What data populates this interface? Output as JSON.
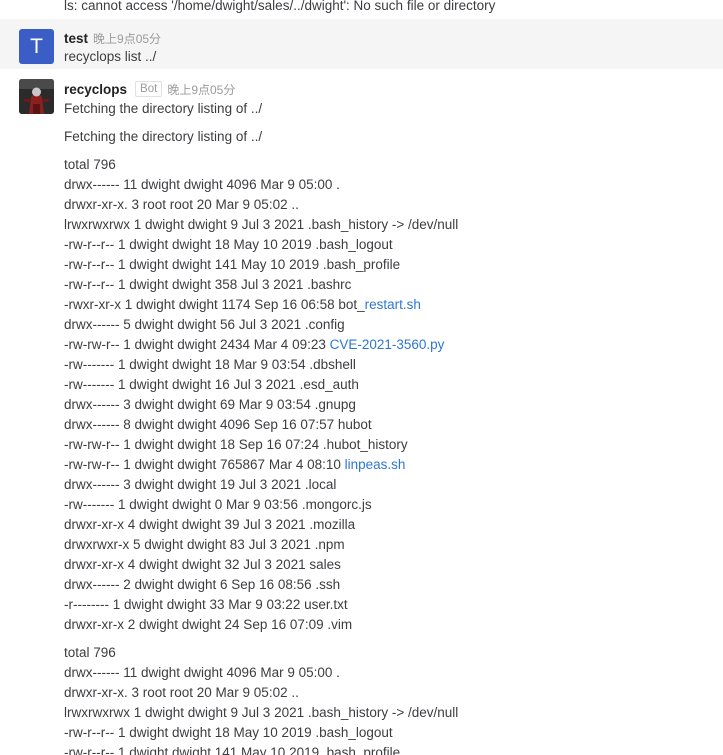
{
  "previous_line": "ls: cannot access '/home/dwight/sales/../dwight': No such file or directory",
  "messages": [
    {
      "author": "test",
      "avatar_letter": "T",
      "time": "晚上9点05分",
      "text": "recyclops list ../"
    },
    {
      "author": "recyclops",
      "badge": "Bot",
      "time": "晚上9点05分",
      "line1": "Fetching the directory listing of ../",
      "line2": "Fetching the directory listing of ../",
      "listing1": [
        {
          "text": "total 796"
        },
        {
          "text": "drwx------ 11 dwight dwight 4096 Mar 9 05:00 ."
        },
        {
          "text": "drwxr-xr-x. 3 root root 20 Mar 9 05:02 .."
        },
        {
          "text": "lrwxrwxrwx 1 dwight dwight 9 Jul 3 2021 .bash_history -> /dev/null"
        },
        {
          "text": "-rw-r--r-- 1 dwight dwight 18 May 10 2019 .bash_logout"
        },
        {
          "text": "-rw-r--r-- 1 dwight dwight 141 May 10 2019 .bash_profile"
        },
        {
          "text": "-rw-r--r-- 1 dwight dwight 358 Jul 3 2021 .bashrc"
        },
        {
          "text": "-rwxr-xr-x 1 dwight dwight 1174 Sep 16 06:58 bot_",
          "link": "restart.sh"
        },
        {
          "text": "drwx------ 5 dwight dwight 56 Jul 3 2021 .config"
        },
        {
          "text": "-rw-rw-r-- 1 dwight dwight 2434 Mar 4 09:23 ",
          "link": "CVE-2021-3560.py"
        },
        {
          "text": "-rw------- 1 dwight dwight 18 Mar 9 03:54 .dbshell"
        },
        {
          "text": "-rw------- 1 dwight dwight 16 Jul 3 2021 .esd_auth"
        },
        {
          "text": "drwx------ 3 dwight dwight 69 Mar 9 03:54 .gnupg"
        },
        {
          "text": "drwx------ 8 dwight dwight 4096 Sep 16 07:57 hubot"
        },
        {
          "text": "-rw-rw-r-- 1 dwight dwight 18 Sep 16 07:24 .hubot_history"
        },
        {
          "text": "-rw-rw-r-- 1 dwight dwight 765867 Mar 4 08:10 ",
          "link": "linpeas.sh"
        },
        {
          "text": "drwx------ 3 dwight dwight 19 Jul 3 2021 .local"
        },
        {
          "text": "-rw------- 1 dwight dwight 0 Mar 9 03:56 .mongorc.js"
        },
        {
          "text": "drwxr-xr-x 4 dwight dwight 39 Jul 3 2021 .mozilla"
        },
        {
          "text": "drwxrwxr-x 5 dwight dwight 83 Jul 3 2021 .npm"
        },
        {
          "text": "drwxr-xr-x 4 dwight dwight 32 Jul 3 2021 sales"
        },
        {
          "text": "drwx------ 2 dwight dwight 6 Sep 16 08:56 .ssh"
        },
        {
          "text": "-r-------- 1 dwight dwight 33 Mar 9 03:22 user.txt"
        },
        {
          "text": "drwxr-xr-x 2 dwight dwight 24 Sep 16 07:09 .vim"
        }
      ],
      "listing2": [
        {
          "text": "total 796"
        },
        {
          "text": "drwx------ 11 dwight dwight 4096 Mar 9 05:00 ."
        },
        {
          "text": "drwxr-xr-x. 3 root root 20 Mar 9 05:02 .."
        },
        {
          "text": "lrwxrwxrwx 1 dwight dwight 9 Jul 3 2021 .bash_history -> /dev/null"
        },
        {
          "text": "-rw-r--r-- 1 dwight dwight 18 May 10 2019 .bash_logout"
        },
        {
          "text": "-rw-r--r-- 1 dwight dwight 141 May 10 2019 .bash_profile"
        }
      ]
    }
  ],
  "colors": {
    "avatar_bg": "#3b5ec6",
    "link": "#2e77d0",
    "highlight_bg": "#f5f5f5"
  }
}
